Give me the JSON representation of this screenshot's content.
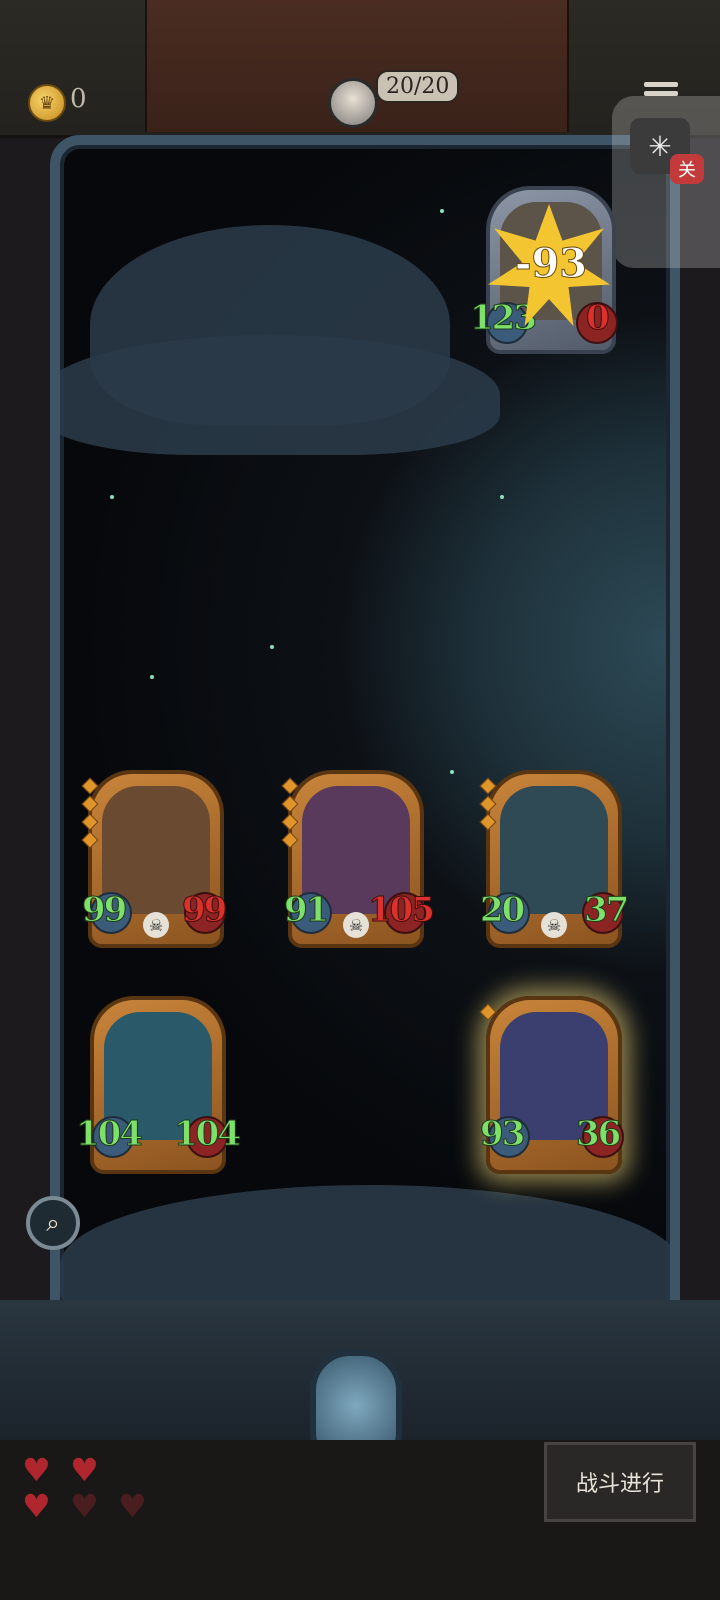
{
  "header": {
    "coins": "0",
    "player_hp": "20/20"
  },
  "float_button": {
    "close_label": "关"
  },
  "enemy_card": {
    "attack": "123",
    "health": "0",
    "damage": "-93"
  },
  "cards": [
    {
      "attack": "99",
      "health": "99",
      "art_color": "#6b4a32"
    },
    {
      "attack": "91",
      "health": "105",
      "art_color": "#5a3a5c"
    },
    {
      "attack": "20",
      "health": "37",
      "art_color": "#2f4a55"
    },
    {
      "attack": "104",
      "health": "104",
      "art_color": "#2a5a6a"
    },
    {
      "attack": "93",
      "health": "36",
      "art_color": "#3a3f70"
    }
  ],
  "footer": {
    "battle_button": "战斗进行",
    "hearts_full": 3,
    "hearts_total": 5
  }
}
